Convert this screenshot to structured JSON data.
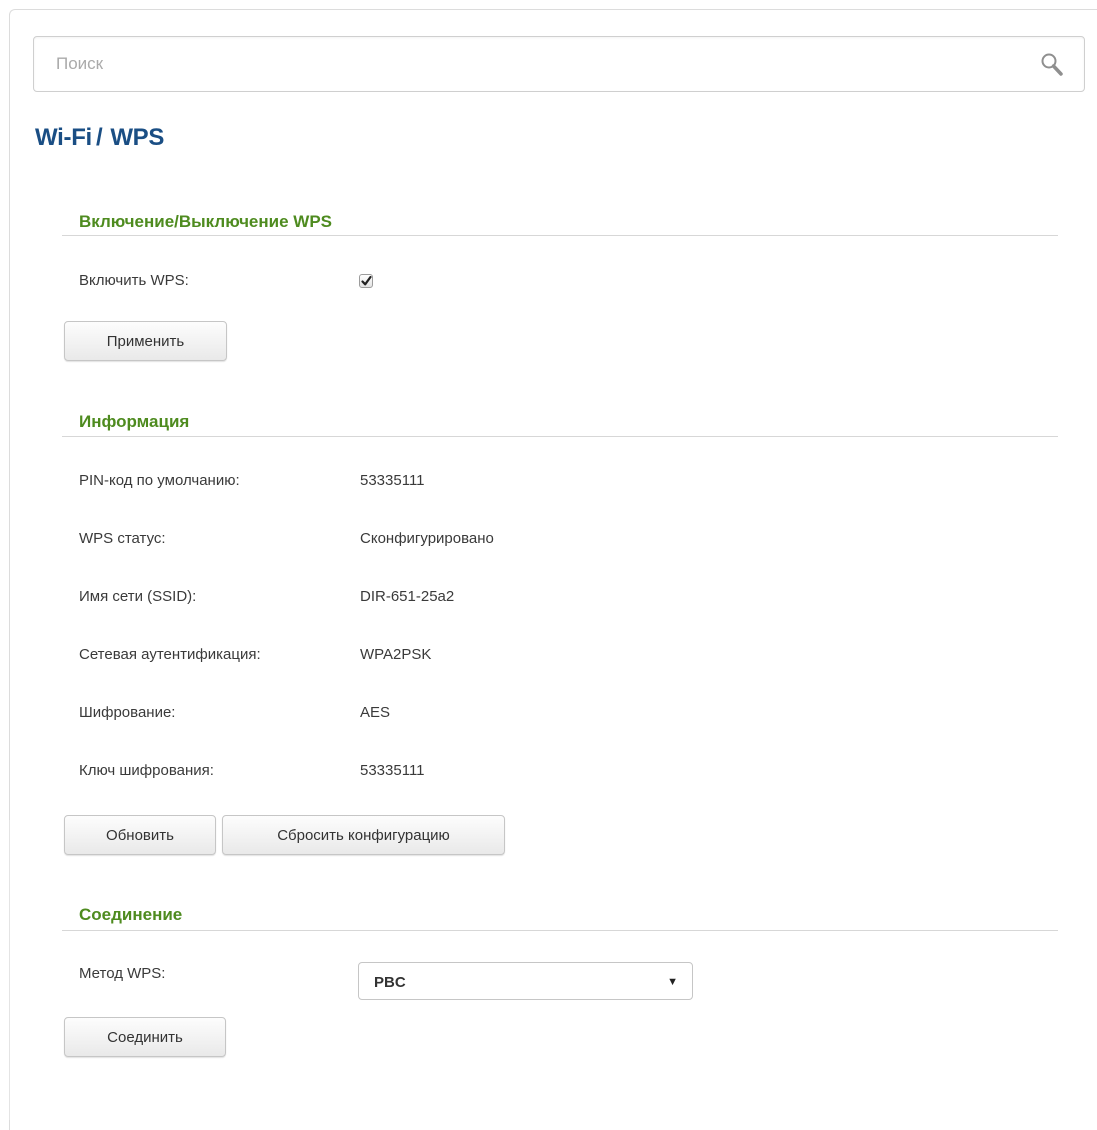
{
  "search": {
    "placeholder": "Поиск",
    "icon": "search-icon"
  },
  "breadcrumb": {
    "section": "Wi-Fi",
    "separator": "/",
    "page": "WPS"
  },
  "enable_section": {
    "title": "Включение/Выключение WPS",
    "enable_label": "Включить WPS:",
    "enable_checked": true,
    "apply_button": "Применить"
  },
  "info_section": {
    "title": "Информация",
    "rows": [
      {
        "label": "PIN-код по умолчанию:",
        "value": "53335111"
      },
      {
        "label": "WPS статус:",
        "value": "Сконфигурировано"
      },
      {
        "label": "Имя сети (SSID):",
        "value": "DIR-651-25a2"
      },
      {
        "label": "Сетевая аутентификация:",
        "value": "WPA2PSK"
      },
      {
        "label": "Шифрование:",
        "value": "AES"
      },
      {
        "label": "Ключ шифрования:",
        "value": "53335111"
      }
    ],
    "refresh_button": "Обновить",
    "reset_button": "Сбросить конфигурацию"
  },
  "connect_section": {
    "title": "Соединение",
    "method_label": "Метод WPS:",
    "method_value": "PBC",
    "connect_button": "Соединить"
  },
  "colors": {
    "title_blue": "#1a4e84",
    "section_green": "#4e8b1f"
  }
}
